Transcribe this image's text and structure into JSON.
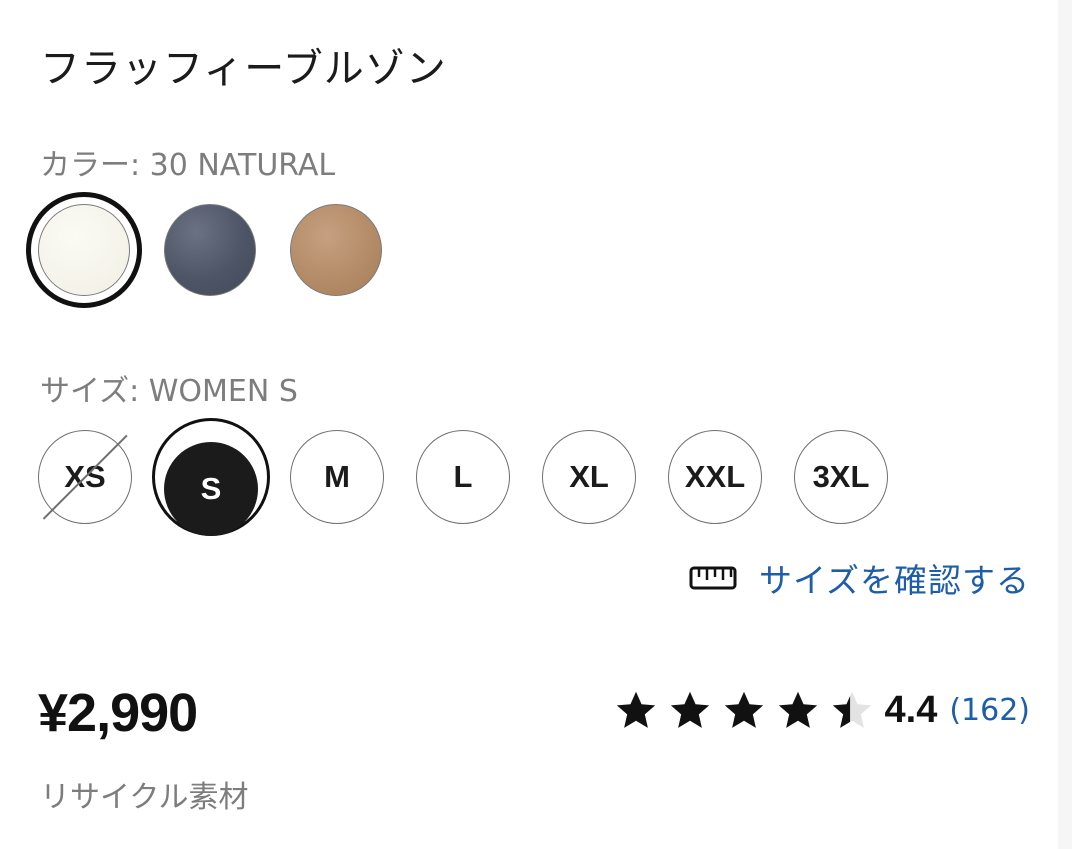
{
  "product": {
    "title": "フラッフィーブルゾン",
    "price": "¥2,990",
    "subtext": "リサイクル素材"
  },
  "color": {
    "label": "カラー: 30 NATURAL",
    "options": [
      {
        "name": "NATURAL",
        "hex": "#f3f1e7",
        "selected": true
      },
      {
        "name": "NAVY",
        "hex": "#535a6b",
        "selected": false
      },
      {
        "name": "CAMEL",
        "hex": "#b38a66",
        "selected": false
      }
    ]
  },
  "size": {
    "label": "サイズ: WOMEN S",
    "options": [
      {
        "label": "XS",
        "state": "unavailable"
      },
      {
        "label": "S",
        "state": "selected"
      },
      {
        "label": "M",
        "state": "available"
      },
      {
        "label": "L",
        "state": "available"
      },
      {
        "label": "XL",
        "state": "available"
      },
      {
        "label": "XXL",
        "state": "available"
      },
      {
        "label": "3XL",
        "state": "available"
      }
    ],
    "guide_link": "サイズを確認する",
    "guide_icon": "ruler-icon"
  },
  "rating": {
    "value": "4.4",
    "count": "(162)",
    "stars_filled": 4.4,
    "stars_total": 5
  },
  "colors": {
    "link": "#1d5da9",
    "text": "#1b1b1b",
    "muted": "#7d7d7d"
  }
}
